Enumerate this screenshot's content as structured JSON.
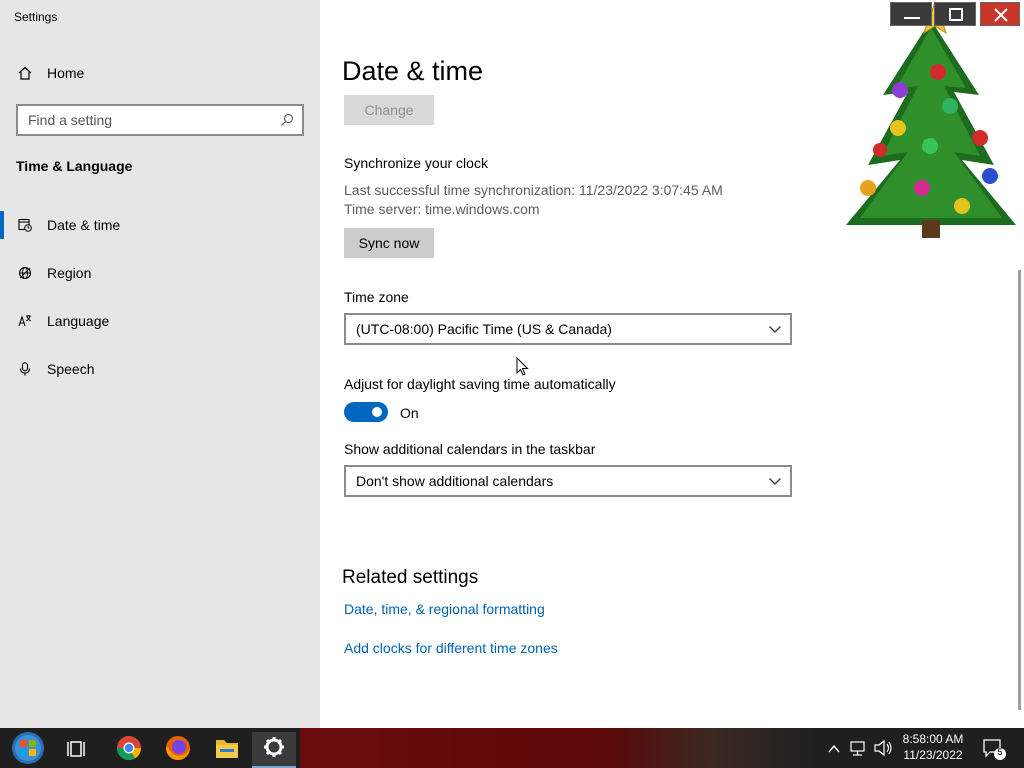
{
  "window": {
    "title": "Settings"
  },
  "sidebar": {
    "home_label": "Home",
    "search_placeholder": "Find a setting",
    "section_title": "Time & Language",
    "items": [
      {
        "label": "Date & time",
        "icon": "calendar-clock-icon",
        "active": true
      },
      {
        "label": "Region",
        "icon": "globe-icon",
        "active": false
      },
      {
        "label": "Language",
        "icon": "language-icon",
        "active": false
      },
      {
        "label": "Speech",
        "icon": "microphone-icon",
        "active": false
      }
    ]
  },
  "main": {
    "title": "Date & time",
    "change_button": "Change",
    "sync": {
      "heading": "Synchronize your clock",
      "last_sync": "Last successful time synchronization: 11/23/2022 3:07:45 AM",
      "time_server": "Time server: time.windows.com",
      "button": "Sync now"
    },
    "time_zone": {
      "label": "Time zone",
      "value": "(UTC-08:00) Pacific Time (US & Canada)"
    },
    "daylight": {
      "label": "Adjust for daylight saving time automatically",
      "state": "On"
    },
    "calendars": {
      "label": "Show additional calendars in the taskbar",
      "value": "Don't show additional calendars"
    },
    "related": {
      "title": "Related settings",
      "links": [
        "Date, time, & regional formatting",
        "Add clocks for different time zones"
      ]
    }
  },
  "taskbar": {
    "time": "8:58:00 AM",
    "date": "11/23/2022",
    "notification_count": "5"
  },
  "colors": {
    "accent": "#0067c0",
    "link": "#0063b1",
    "sidebar_bg": "#e6e6e6"
  }
}
